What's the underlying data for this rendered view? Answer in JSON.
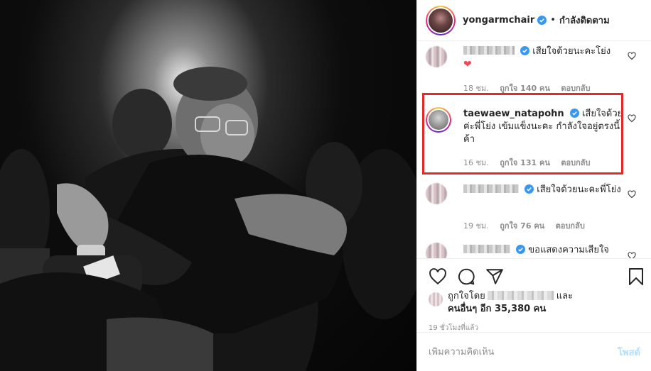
{
  "header": {
    "username": "yongarmchair",
    "separator": "•",
    "follow_status": "กำลังติดตาม"
  },
  "comments": [
    {
      "username_hidden": true,
      "text": "เสียใจด้วยนะคะโย่ง",
      "emoji": "❤",
      "time": "18 ชม.",
      "likes": "ถูกใจ 140 คน",
      "reply": "ตอบกลับ"
    },
    {
      "username": "taewaew_natapohn",
      "text": "เสียใจด้วยค่ะพี่โย่ง เข้มแข็งนะคะ กำลังใจอยู่ตรงนี้ค้า",
      "time": "16 ชม.",
      "likes": "ถูกใจ 131 คน",
      "reply": "ตอบกลับ",
      "highlighted": true
    },
    {
      "username_hidden": true,
      "text": "เสียใจด้วยนะคะพี่โย่ง",
      "time": "19 ชม.",
      "likes": "ถูกใจ 76 คน",
      "reply": "ตอบกลับ"
    },
    {
      "username_hidden": true,
      "text": "ขอแสดงความเสียใจ"
    }
  ],
  "likes_summary": {
    "prefix": "ถูกใจโดย",
    "conjunction": "และ",
    "others": "คนอื่นๆ อีก 35,380 คน"
  },
  "time_ago": "19 ชั่วโมงที่แล้ว",
  "add_comment": {
    "placeholder": "เพิ่มความคิดเห็น",
    "post_label": "โพสต์"
  },
  "colors": {
    "verified": "#3897f0",
    "highlight_border": "#e32a2a",
    "post_disabled": "#b2dffc",
    "meta_text": "#8e8e8e"
  }
}
